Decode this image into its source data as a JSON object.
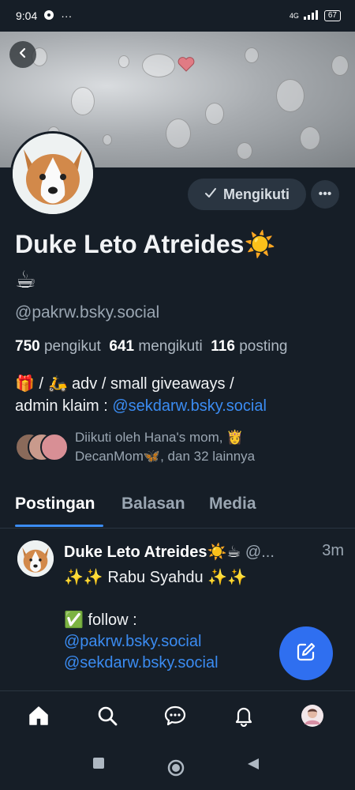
{
  "status_bar": {
    "time": "9:04",
    "signal": "4G",
    "battery": "67"
  },
  "profile": {
    "display_name": "Duke Leto Atreides☀️",
    "display_name_line2": "☕",
    "handle": "@pakrw.bsky.social",
    "follow_button_label": "Mengikuti",
    "stats": {
      "followers_count": "750",
      "followers_label": "pengikut",
      "following_count": "641",
      "following_label": "mengikuti",
      "posts_count": "116",
      "posts_label": "posting"
    },
    "bio_line1": "🎁 / 🛵 adv / small giveaways /",
    "bio_line2_prefix": "admin klaim : ",
    "bio_link": "@sekdarw.bsky.social",
    "followed_by_line1": "Diikuti oleh Hana's mom, 👸",
    "followed_by_line2": "DecanMom🦋, dan 32 lainnya"
  },
  "tabs": [
    "Postingan",
    "Balasan",
    "Media"
  ],
  "post": {
    "author": "Duke Leto Atreides☀️☕",
    "handle_truncated": "@...",
    "time": "3m",
    "line1": "✨✨ Rabu Syahdu ✨✨",
    "line2": "✅ follow :",
    "mention1": "@pakrw.bsky.social",
    "mention2": "@sekdarw.bsky.social"
  },
  "icons": {
    "back": "back-arrow-icon",
    "check": "check-icon",
    "more": "more-icon",
    "compose": "compose-icon",
    "home": "home-icon",
    "search": "search-icon",
    "chat": "chat-icon",
    "notifications": "bell-icon",
    "profile": "avatar"
  },
  "colors": {
    "background": "#161e27",
    "accent": "#3b8cf2",
    "fab": "#2f6ff0"
  }
}
